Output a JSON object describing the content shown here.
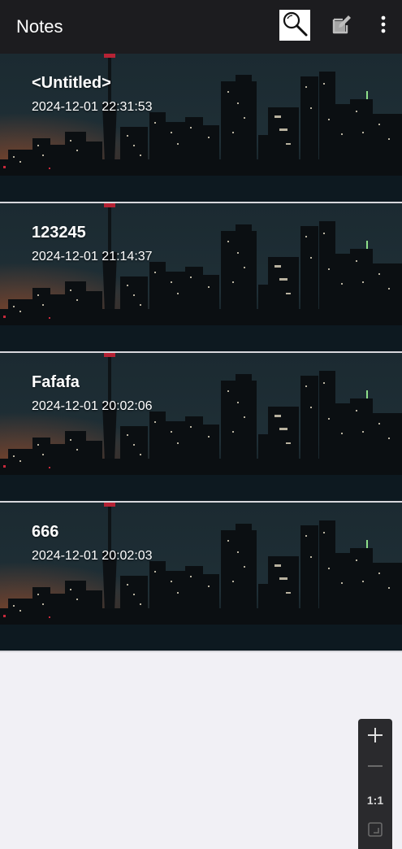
{
  "app": {
    "title": "Notes"
  },
  "toolbar": {
    "search_icon": "search-icon",
    "new_note_icon": "edit-note-icon",
    "more_icon": "more-vert-icon"
  },
  "notes": [
    {
      "title": "<Untitled>",
      "timestamp": "2024-12-01 22:31:53"
    },
    {
      "title": "123245",
      "timestamp": "2024-12-01 21:14:37"
    },
    {
      "title": "Fafafa",
      "timestamp": "2024-12-01 20:02:06"
    },
    {
      "title": "666",
      "timestamp": "2024-12-01 20:02:03"
    }
  ],
  "zoom_controls": {
    "zoom_in_icon": "plus-icon",
    "zoom_out_icon": "minus-icon",
    "reset_label": "1:1",
    "fit_icon": "fit-screen-icon"
  },
  "colors": {
    "toolbar_bg": "#1c1c1f",
    "page_bg": "#f1f0f5",
    "text_on_dark": "#ffffff"
  }
}
